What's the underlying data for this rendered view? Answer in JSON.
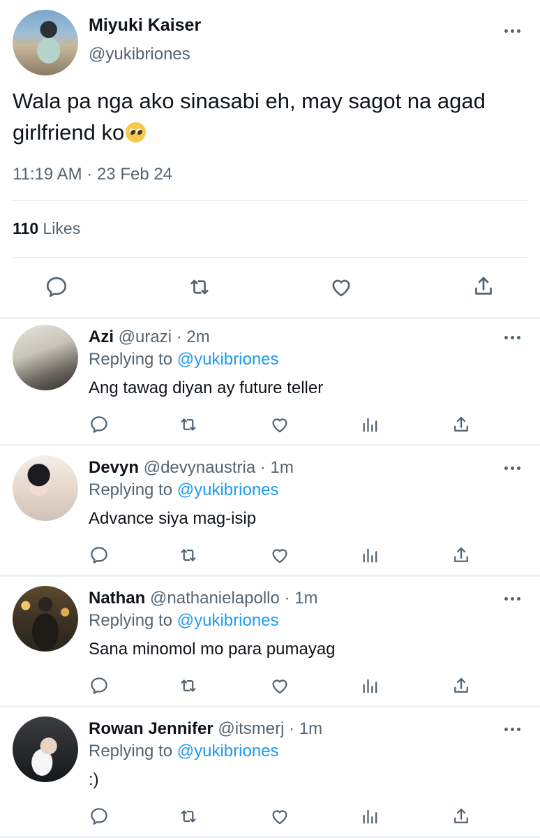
{
  "tweet": {
    "author_name": "Miyuki Kaiser",
    "author_handle": "@yukibriones",
    "text_line1": "Wala pa nga ako sinasabi eh, may sagot na agad",
    "text_line2": "girlfriend ko",
    "emoji": "pleading-face",
    "timestamp": "11:19 AM · 23 Feb 24",
    "likes_count": "110",
    "likes_label": "Likes"
  },
  "replying_prefix": "Replying to",
  "replies": [
    {
      "name": "Azi",
      "handle": "@urazi",
      "time": "· 2m",
      "replying_to": "@yukibriones",
      "text": "Ang tawag diyan ay future teller"
    },
    {
      "name": "Devyn",
      "handle": "@devynaustria",
      "time": "· 1m",
      "replying_to": "@yukibriones",
      "text": "Advance siya mag-isip"
    },
    {
      "name": "Nathan",
      "handle": "@nathanielapollo",
      "time": "· 1m",
      "replying_to": "@yukibriones",
      "text": "Sana minomol mo para pumayag"
    },
    {
      "name": "Rowan Jennifer",
      "handle": "@itsmerj",
      "time": "· 1m",
      "replying_to": "@yukibriones",
      "text": ":)"
    }
  ],
  "colors": {
    "link": "#1d9bf0",
    "secondary_text": "#536471",
    "primary_text": "#0f1419"
  }
}
